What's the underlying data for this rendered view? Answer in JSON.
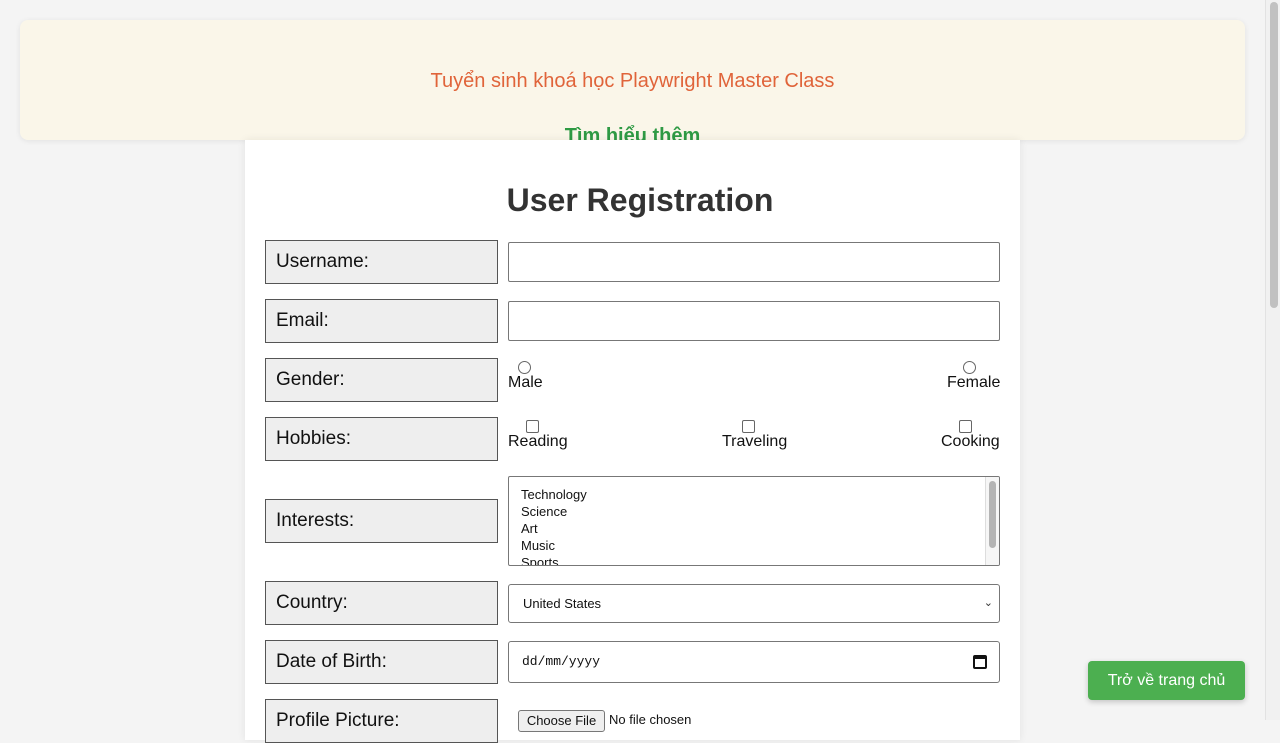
{
  "banner": {
    "title": "Tuyển sinh khoá học Playwright Master Class",
    "link": "Tìm hiểu thêm"
  },
  "form": {
    "title": "User Registration",
    "username_label": "Username:",
    "username_value": "",
    "email_label": "Email:",
    "email_value": "",
    "gender_label": "Gender:",
    "gender_options": [
      "Male",
      "Female"
    ],
    "hobbies_label": "Hobbies:",
    "hobby_options": [
      "Reading",
      "Traveling",
      "Cooking"
    ],
    "interests_label": "Interests:",
    "interests_options": [
      "Technology",
      "Science",
      "Art",
      "Music",
      "Sports"
    ],
    "country_label": "Country:",
    "country_value": "United States",
    "dob_label": "Date of Birth:",
    "dob_placeholder": "dd/mm/yyyy",
    "profile_label": "Profile Picture:",
    "file_button": "Choose File",
    "file_status": "No file chosen"
  },
  "home_button": "Trở về trang chủ",
  "colors": {
    "banner_bg": "#faf6e9",
    "banner_title": "#e0643a",
    "banner_link": "#2e9a44",
    "home_button": "#4caf50"
  }
}
